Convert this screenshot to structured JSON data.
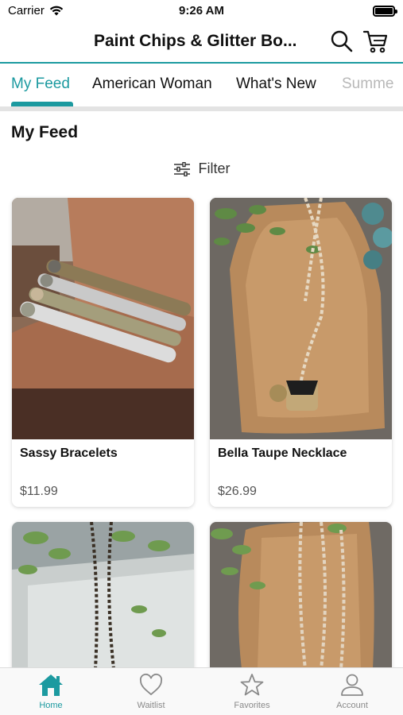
{
  "status_bar": {
    "carrier": "Carrier",
    "time": "9:26 AM"
  },
  "header": {
    "title": "Paint Chips & Glitter Bo..."
  },
  "tabs": [
    {
      "label": "My Feed",
      "active": true
    },
    {
      "label": "American Woman"
    },
    {
      "label": "What's New"
    },
    {
      "label": "Summe"
    }
  ],
  "section_title": "My Feed",
  "filter_label": "Filter",
  "products": [
    {
      "name": "Sassy Bracelets",
      "price": "$11.99"
    },
    {
      "name": "Bella Taupe Necklace",
      "price": "$26.99"
    },
    {
      "name": "",
      "price": ""
    },
    {
      "name": "",
      "price": ""
    }
  ],
  "bottom_nav": [
    {
      "label": "Home",
      "icon": "home-icon",
      "active": true
    },
    {
      "label": "Waitlist",
      "icon": "heart-icon"
    },
    {
      "label": "Favorites",
      "icon": "star-icon"
    },
    {
      "label": "Account",
      "icon": "person-icon"
    }
  ],
  "colors": {
    "accent": "#1c9aa0",
    "inactive": "#8a8a8a"
  }
}
